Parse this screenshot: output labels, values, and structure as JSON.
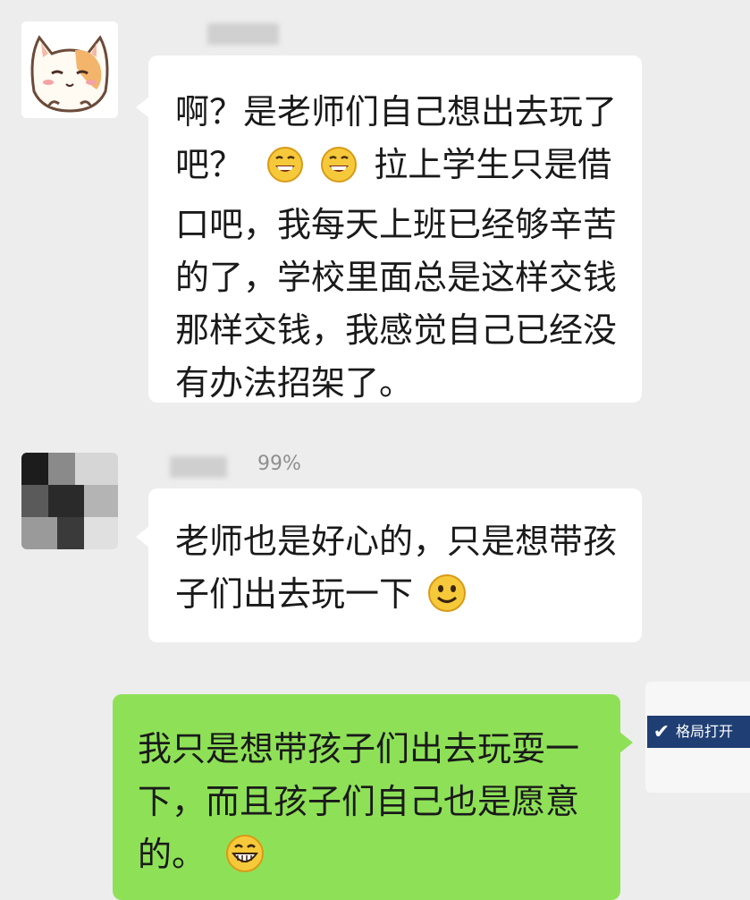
{
  "messages": [
    {
      "side": "left",
      "lines": [
        "啊？是老师们自己想出去玩了",
        "吧？",
        "拉上学生只是借",
        "口吧，我每天上班已经够辛苦",
        "的了，学校里面总是这样交钱",
        "那样交钱，我感觉自己已经没",
        "有办法招架了。"
      ],
      "emojis": [
        "grinning-emoji",
        "grinning-emoji"
      ]
    },
    {
      "side": "left",
      "meta": "99%",
      "lines": [
        "老师也是好心的，只是想带孩",
        "子们出去玩一下"
      ],
      "emojis": [
        "smiling-emoji"
      ]
    },
    {
      "side": "right",
      "lines": [
        "我只是想带孩子们出去玩耍一",
        "下，而且孩子们自己也是愿意",
        "的。"
      ],
      "emojis": [
        "big-grin-emoji"
      ]
    }
  ],
  "badge": {
    "label": "格局打开"
  },
  "colors": {
    "background": "#ededed",
    "bubble_white": "#ffffff",
    "bubble_green": "#8ee157",
    "text": "#1a1a1a",
    "emoji_yellow": "#f6c93a",
    "badge_blue": "#1f3f74"
  }
}
